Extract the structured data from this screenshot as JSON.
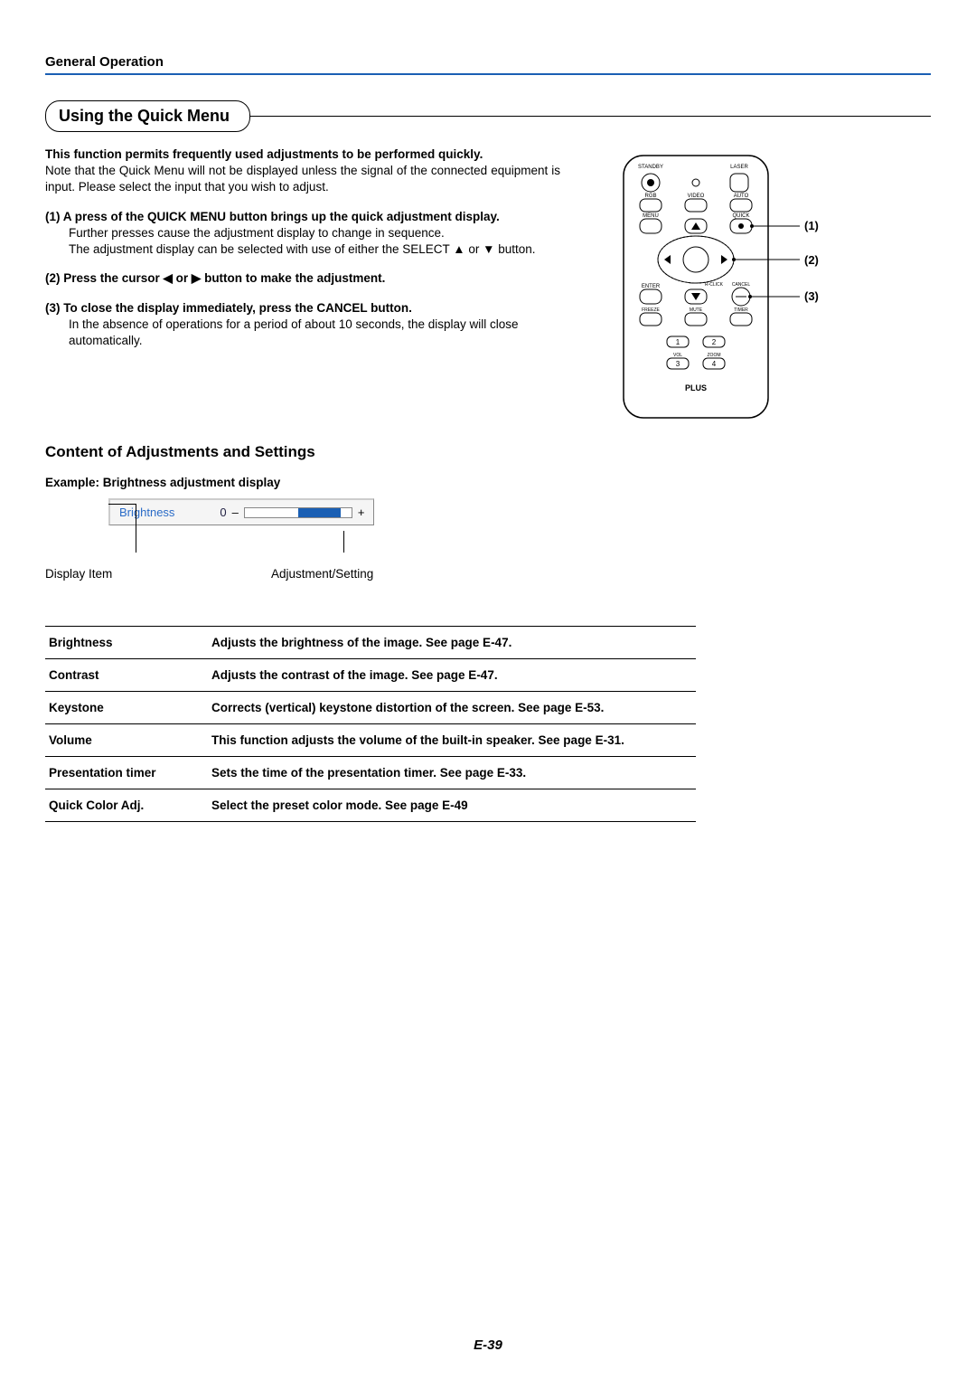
{
  "header": "General Operation",
  "section_title": "Using the Quick Menu",
  "intro_bold": "This function permits frequently used adjustments to be performed quickly.",
  "intro_note": "Note that the Quick Menu will not be displayed unless the signal of the connected equipment is input. Please select the input that you wish to adjust.",
  "steps": {
    "s1_head": "(1) A press of the QUICK MENU button brings up the quick adjustment display.",
    "s1_body1": "Further presses cause the adjustment display to change in sequence.",
    "s1_body2": "The adjustment display can be selected with use of either the SELECT ▲ or ▼ button.",
    "s2_head": "(2) Press the cursor ◀ or ▶ button to make the adjustment.",
    "s3_head": "(3) To close the display immediately, press the CANCEL button.",
    "s3_body": "In the absence of operations for a period of about 10 seconds, the display will close automatically."
  },
  "subheading": "Content of Adjustments and Settings",
  "example_label": "Example: Brightness adjustment display",
  "osd": {
    "item_name": "Brightness",
    "value": "0",
    "minus": "–",
    "plus": "+"
  },
  "caption1": "Display Item",
  "caption2": "Adjustment/Setting",
  "table": [
    {
      "name": "Brightness",
      "desc": "Adjusts the brightness of the image. See page E-47."
    },
    {
      "name": "Contrast",
      "desc": "Adjusts the contrast of the image. See page E-47."
    },
    {
      "name": "Keystone",
      "desc": "Corrects (vertical) keystone distortion of the screen.  See page E-53."
    },
    {
      "name": "Volume",
      "desc": "This function adjusts the volume of the built-in speaker. See page E-31."
    },
    {
      "name": "Presentation timer",
      "desc": "Sets the time of the presentation timer.  See page E-33."
    },
    {
      "name": "Quick Color Adj.",
      "desc": "Select the preset color mode. See page E-49"
    }
  ],
  "remote": {
    "labels": {
      "standby": "STANDBY",
      "laser": "LASER",
      "rgb": "RGB",
      "video": "VIDEO",
      "auto": "AUTO",
      "menu": "MENU",
      "quick": "QUICK",
      "enter": "ENTER",
      "rclick": "R-CLICK",
      "cancel": "CANCEL",
      "freeze": "FREEZE",
      "mute": "MUTE",
      "timer": "TIMER",
      "vol": "VOL",
      "zoom": "ZOOM",
      "n1": "1",
      "n2": "2",
      "n3": "3",
      "n4": "4",
      "brand": "PLUS"
    },
    "callouts": {
      "c1": "(1)",
      "c2": "(2)",
      "c3": "(3)"
    }
  },
  "page_number": "E-39"
}
